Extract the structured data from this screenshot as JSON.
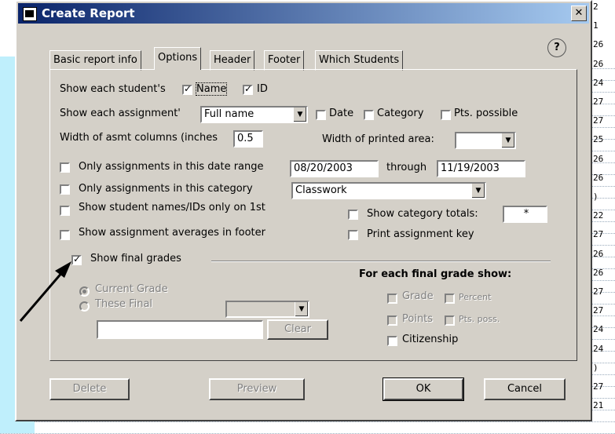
{
  "background": {
    "row_numbers": [
      "2",
      "1",
      "26",
      "26",
      "24",
      "27",
      "27",
      "25",
      "26",
      "26",
      ")",
      "22",
      "27",
      "26",
      "26",
      "27",
      "27",
      "24",
      "24",
      ")",
      "27",
      "21"
    ]
  },
  "dialog": {
    "title": "Create Report",
    "close_glyph": "✕",
    "help_glyph": "?",
    "tabs": [
      "Basic report info",
      "Options",
      "Header",
      "Footer",
      "Which Students"
    ],
    "active_tab": "Options",
    "options": {
      "show_each_student": "Show each student's",
      "name_label": "Name",
      "id_label": "ID",
      "show_each_assignment": "Show each assignment'",
      "assignment_value": "Full name",
      "date_label": "Date",
      "category_label": "Category",
      "pts_possible_label": "Pts. possible",
      "width_asmt": "Width of asmt columns (inches",
      "width_asmt_value": "0.5",
      "width_printed": "Width of printed area:",
      "width_printed_value": "",
      "date_range_label": "Only assignments in this date range",
      "date_from": "08/20/2003",
      "through_label": "through",
      "date_to": "11/19/2003",
      "category_only_label": "Only assignments in this category",
      "category_value": "Classwork",
      "names_first_label": "Show student names/IDs only on 1st",
      "category_totals_label": "Show category totals:",
      "category_totals_value": "*",
      "averages_footer_label": "Show assignment averages in footer",
      "print_key_label": "Print assignment key",
      "final_grades_label": "Show final grades",
      "current_grade_label": "Current Grade",
      "these_final_label": "These Final",
      "these_final_value": "",
      "final_text_value": "",
      "clear_label": "Clear",
      "each_final_heading": "For each final grade show:",
      "grade_label": "Grade",
      "percent_label": "Percent",
      "points_label": "Points",
      "pts_poss_label": "Pts. poss.",
      "citizenship_label": "Citizenship"
    },
    "buttons": {
      "delete": "Delete",
      "preview": "Preview",
      "ok": "OK",
      "cancel": "Cancel"
    }
  }
}
